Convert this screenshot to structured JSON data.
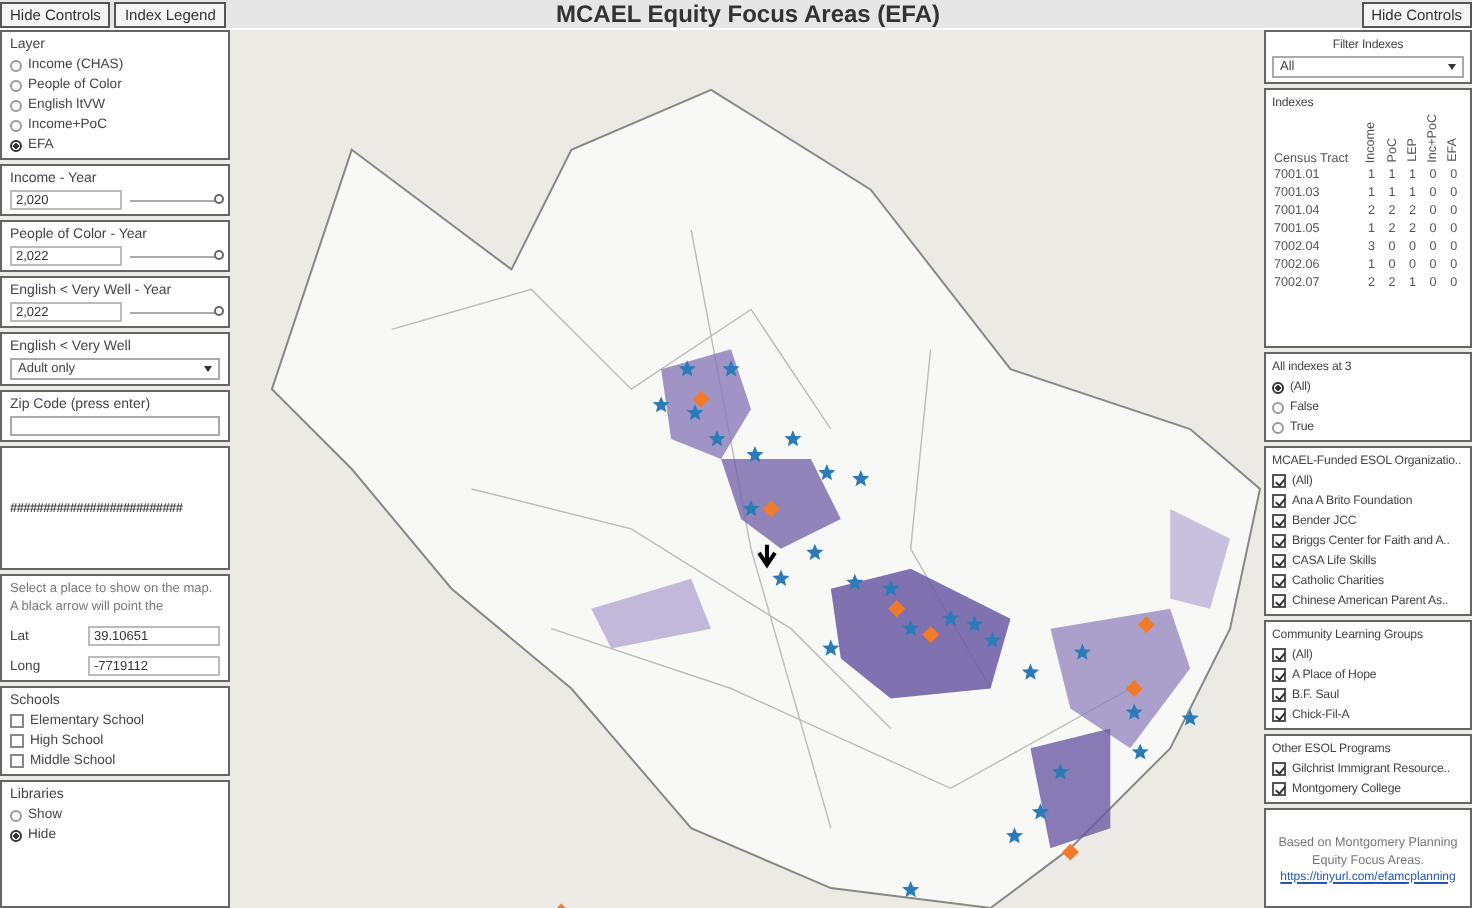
{
  "header": {
    "left_buttons": [
      "Hide Controls",
      "Index Legend"
    ],
    "title": "MCAEL Equity Focus Areas (EFA)",
    "right_button": "Hide Controls"
  },
  "layer": {
    "label": "Layer",
    "options": [
      {
        "label": "Income (CHAS)",
        "selected": false
      },
      {
        "label": "People of Color",
        "selected": false
      },
      {
        "label": "English ltVW",
        "selected": false
      },
      {
        "label": "Income+PoC",
        "selected": false
      },
      {
        "label": "EFA",
        "selected": true
      }
    ]
  },
  "year_sliders": [
    {
      "label": "Income - Year",
      "value": "2,020",
      "level": 1
    },
    {
      "label": "People of Color - Year",
      "value": "2,022",
      "level": 1
    },
    {
      "label": "English < Very Well - Year",
      "value": "2,022",
      "level": 1
    }
  ],
  "english_level": {
    "label": "English < Very Well",
    "value": "Adult only"
  },
  "zip_code": {
    "label": "Zip Code (press enter)"
  },
  "hash_text": "##########################",
  "locate": {
    "text": "Select a place to show on the map. A black arrow will point the",
    "fields": [
      {
        "label": "Lat",
        "value": "39.10651"
      },
      {
        "label": "Long",
        "value": "-7719112"
      }
    ]
  },
  "schools": {
    "label": "Schools",
    "items": [
      {
        "label": "Elementary School",
        "checked": false
      },
      {
        "label": "High School",
        "checked": false
      },
      {
        "label": "Middle School",
        "checked": false
      }
    ]
  },
  "libraries": {
    "label": "Libraries",
    "options": [
      {
        "label": "Show",
        "selected": false
      },
      {
        "label": "Hide",
        "selected": true
      }
    ]
  },
  "filter_indexes": {
    "label": "Filter Indexes",
    "value": "All"
  },
  "indexes": {
    "title": "Indexes",
    "columns": [
      "Census Tract",
      "Income",
      "PoC",
      "LEP",
      "Inc+PoC",
      "EFA"
    ],
    "rows": [
      [
        "7001.01",
        "1",
        "1",
        "1",
        "0",
        "0"
      ],
      [
        "7001.03",
        "1",
        "1",
        "1",
        "0",
        "0"
      ],
      [
        "7001.04",
        "2",
        "2",
        "2",
        "0",
        "0"
      ],
      [
        "7001.05",
        "1",
        "2",
        "2",
        "0",
        "0"
      ],
      [
        "7002.04",
        "3",
        "0",
        "0",
        "0",
        "0"
      ],
      [
        "7002.06",
        "1",
        "0",
        "0",
        "0",
        "0"
      ],
      [
        "7002.07",
        "2",
        "2",
        "1",
        "0",
        "0"
      ]
    ]
  },
  "all_indexes_at_3": {
    "label": "All indexes at 3",
    "options": [
      {
        "label": "(All)",
        "selected": true
      },
      {
        "label": "False",
        "selected": false
      },
      {
        "label": "True",
        "selected": false
      }
    ]
  },
  "check_groups": [
    {
      "title": "MCAEL-Funded ESOL Organizatio..",
      "items": [
        {
          "label": "(All)",
          "checked": true
        },
        {
          "label": "Ana A Brito Foundation",
          "checked": true
        },
        {
          "label": "Bender JCC",
          "checked": true
        },
        {
          "label": "Briggs Center for Faith and A..",
          "checked": true
        },
        {
          "label": "CASA Life Skills",
          "checked": true
        },
        {
          "label": "Catholic Charities",
          "checked": true
        },
        {
          "label": "Chinese American Parent As..",
          "checked": true
        }
      ]
    },
    {
      "title": "Community Learning Groups",
      "items": [
        {
          "label": "(All)",
          "checked": true
        },
        {
          "label": "A Place of Hope",
          "checked": true
        },
        {
          "label": "B.F. Saul",
          "checked": true
        },
        {
          "label": "Chick-Fil-A",
          "checked": true
        }
      ]
    },
    {
      "title": "Other ESOL Programs",
      "items": [
        {
          "label": "Gilchrist Immigrant Resource..",
          "checked": true
        },
        {
          "label": "Montgomery College",
          "checked": true
        }
      ]
    }
  ],
  "footer": {
    "text": "Based on Montgomery Planning Equity Focus Areas.",
    "link": "https://tinyurl.com/efamcplanning"
  }
}
